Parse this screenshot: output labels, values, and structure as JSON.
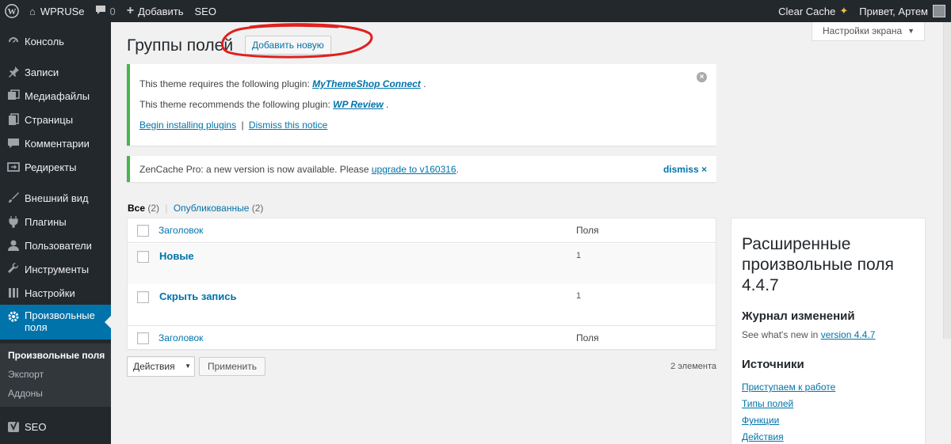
{
  "admin_bar": {
    "site_name": "WPRUSe",
    "comments_count": "0",
    "add_new": "Добавить",
    "seo": "SEO",
    "clear_cache": "Clear Cache",
    "greeting": "Привет, Артем"
  },
  "sidebar": {
    "items": [
      {
        "label": "Консоль",
        "icon": "dashboard-icon"
      },
      {
        "label": "Записи",
        "icon": "pushpin-icon"
      },
      {
        "label": "Медиафайлы",
        "icon": "media-icon"
      },
      {
        "label": "Страницы",
        "icon": "pages-icon"
      },
      {
        "label": "Комментарии",
        "icon": "comments-icon"
      },
      {
        "label": "Редиректы",
        "icon": "redirect-icon"
      },
      {
        "label": "Внешний вид",
        "icon": "appearance-icon"
      },
      {
        "label": "Плагины",
        "icon": "plugins-icon"
      },
      {
        "label": "Пользователи",
        "icon": "users-icon"
      },
      {
        "label": "Инструменты",
        "icon": "tools-icon"
      },
      {
        "label": "Настройки",
        "icon": "settings-icon"
      },
      {
        "label": "Произвольные поля",
        "icon": "gear-icon"
      },
      {
        "label": "SEO",
        "icon": "yoast-icon"
      }
    ],
    "submenu": [
      "Произвольные поля",
      "Экспорт",
      "Аддоны"
    ]
  },
  "page": {
    "title": "Группы полей",
    "add_new_button": "Добавить новую",
    "screen_options": "Настройки экрана"
  },
  "notices": {
    "plugin_required_prefix": "This theme requires the following plugin: ",
    "plugin_required_link": "MyThemeShop Connect",
    "plugin_recommended_prefix": "This theme recommends the following plugin: ",
    "plugin_recommended_link": "WP Review",
    "begin_installing": "Begin installing plugins",
    "separator": "|",
    "dismiss_notice": "Dismiss this notice",
    "zencache_name": "ZenCache Pro:",
    "zencache_text": " a new version is now available. Please ",
    "zencache_link": "upgrade to v160316",
    "zencache_dismiss": "dismiss ×"
  },
  "filters": {
    "all": "Все",
    "all_count": "(2)",
    "published": "Опубликованные",
    "published_count": "(2)"
  },
  "table": {
    "columns": {
      "title": "Заголовок",
      "fields": "Поля"
    },
    "rows": [
      {
        "title": "Новые",
        "fields": "1"
      },
      {
        "title": "Скрыть запись",
        "fields": "1"
      }
    ]
  },
  "bulk_actions": {
    "select_label": "Действия",
    "apply": "Применить",
    "items_count": "2 элемента"
  },
  "side_panel": {
    "title": "Расширенные произвольные поля 4.4.7",
    "changelog_heading": "Журнал изменений",
    "changelog_text": "See what's new in ",
    "changelog_link": "version 4.4.7",
    "resources_heading": "Источники",
    "resources_links": [
      "Приступаем к работе",
      "Типы полей",
      "Функции",
      "Действия"
    ]
  },
  "colors": {
    "adminbar_bg": "#23282d",
    "current_menu": "#0073aa",
    "link": "#0073aa",
    "notice_border": "#46b450",
    "annotation_red": "#e02020"
  }
}
